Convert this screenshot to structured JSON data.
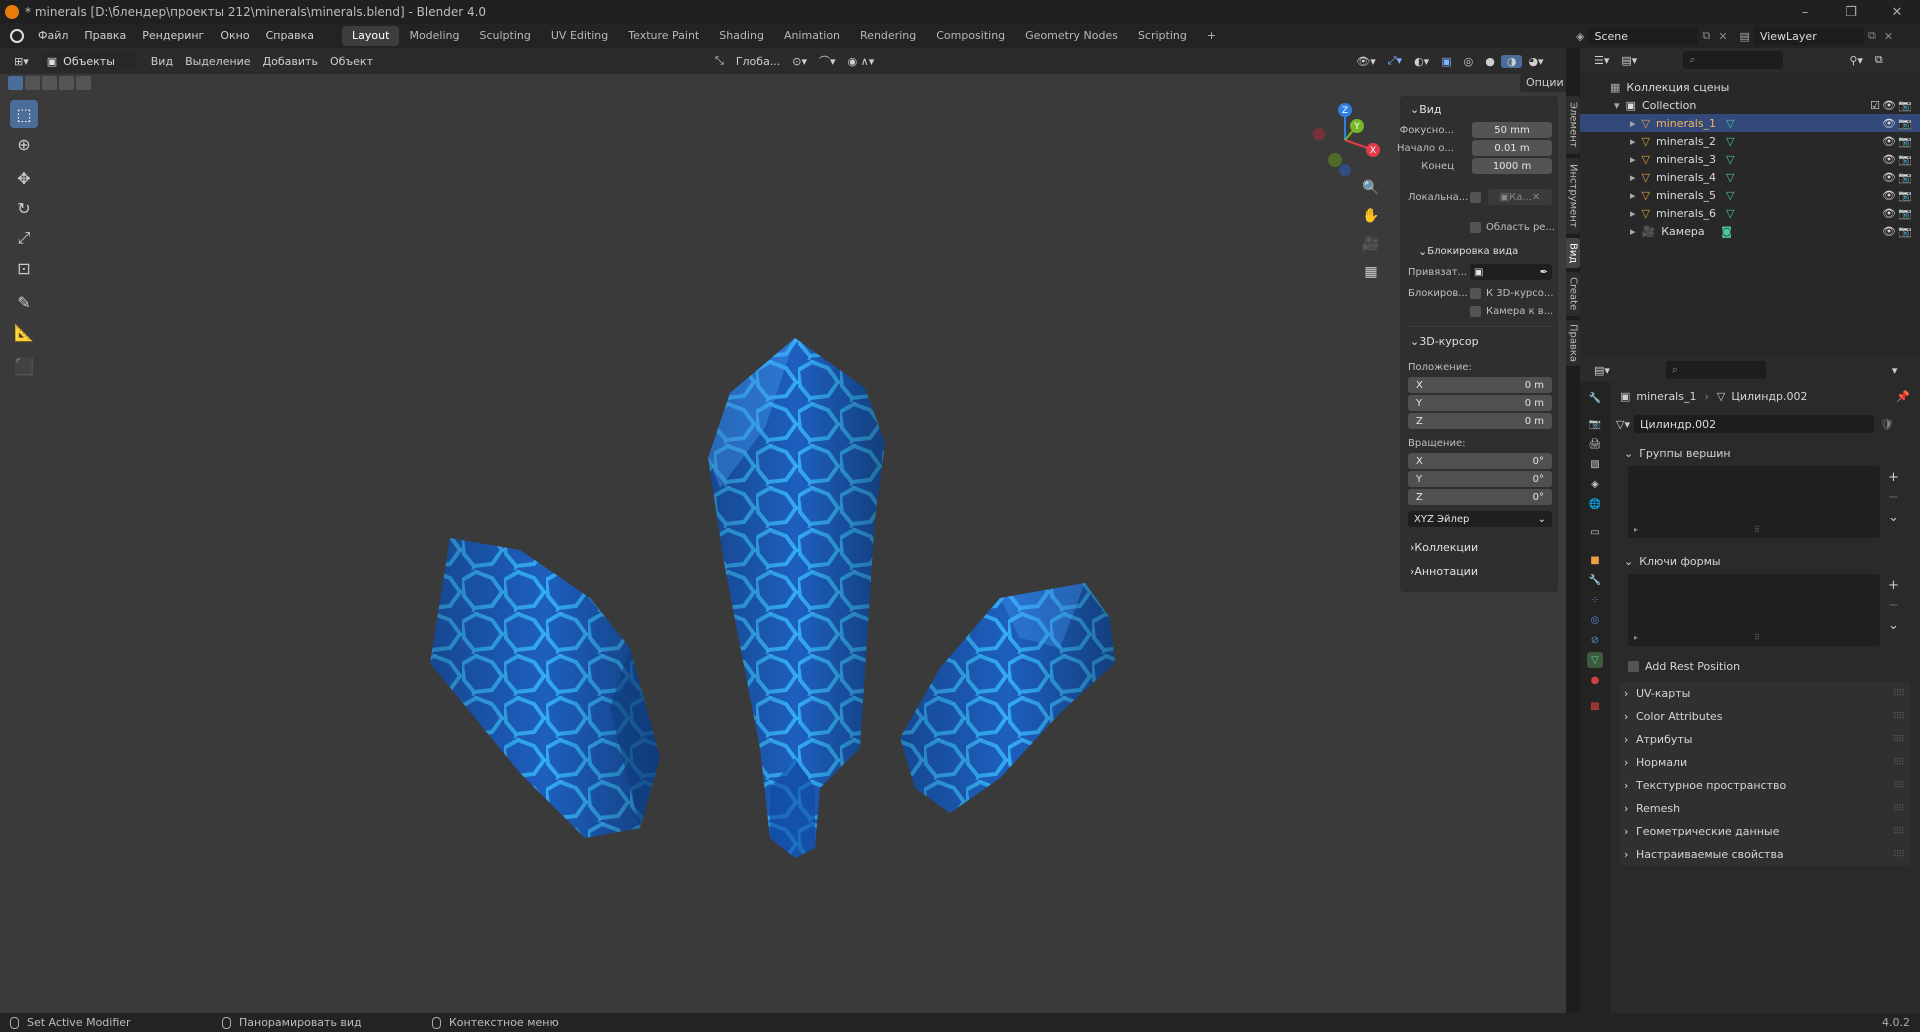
{
  "titlebar": {
    "title": "* minerals [D:\\блендер\\проекты 212\\minerals\\minerals.blend] - Blender 4.0"
  },
  "menus": [
    "Файл",
    "Правка",
    "Рендеринг",
    "Окно",
    "Справка"
  ],
  "workspaces": [
    "Layout",
    "Modeling",
    "Sculpting",
    "UV Editing",
    "Texture Paint",
    "Shading",
    "Animation",
    "Rendering",
    "Compositing",
    "Geometry Nodes",
    "Scripting"
  ],
  "scene": {
    "name": "Scene",
    "view_layer": "ViewLayer"
  },
  "viewport_header": {
    "mode": "Объекты",
    "menus": [
      "Вид",
      "Выделение",
      "Добавить",
      "Объект"
    ],
    "transform_orientation": "Глоба...",
    "options": "Опции"
  },
  "npanel": {
    "view_title": "Вид",
    "focal_label": "Фокусно...",
    "focal_value": "50 mm",
    "clip_start_label": "Начало о...",
    "clip_start_value": "0.01 m",
    "clip_end_label": "Конец",
    "clip_end_value": "1000 m",
    "local_label": "Локальна...",
    "local_value": "Ка...",
    "region_label": "Область ре...",
    "lock_title": "Блокировка вида",
    "lock_to_label": "Привязат...",
    "lock_label": "Блокиров...",
    "lock_cursor": "К 3D-курсо...",
    "lock_camera": "Камера к в...",
    "cursor_title": "3D-курсор",
    "location_label": "Положение:",
    "loc_x_label": "X",
    "loc_x": "0 m",
    "loc_y_label": "Y",
    "loc_y": "0 m",
    "loc_z_label": "Z",
    "loc_z": "0 m",
    "rotation_label": "Вращение:",
    "rot_x_label": "X",
    "rot_x": "0°",
    "rot_y_label": "Y",
    "rot_y": "0°",
    "rot_z_label": "Z",
    "rot_z": "0°",
    "rot_mode": "XYZ Эйлер",
    "collections": "Коллекции",
    "annotations": "Аннотации"
  },
  "side_tabs": [
    "Элемент",
    "Инструмент",
    "Вид",
    "Create",
    "Правка"
  ],
  "outliner": {
    "root": "Коллекция сцены",
    "collection": "Collection",
    "objects": [
      "minerals_1",
      "minerals_2",
      "minerals_3",
      "minerals_4",
      "minerals_5",
      "minerals_6"
    ],
    "camera": "Камера"
  },
  "properties": {
    "object": "minerals_1",
    "mesh": "Цилиндр.002",
    "mesh_field": "Цилиндр.002",
    "vertex_groups": "Группы вершин",
    "shape_keys": "Ключи формы",
    "add_rest_position": "Add Rest Position",
    "panels": [
      "UV-карты",
      "Color Attributes",
      "Атрибуты",
      "Нормали",
      "Текстурное пространство",
      "Remesh",
      "Геометрические данные",
      "Настраиваемые свойства"
    ]
  },
  "statusbar": {
    "left": "Set Active Modifier",
    "middle": "Панорамировать вид",
    "right": "Контекстное меню",
    "version": "4.0.2"
  },
  "colors": {
    "accent": "#4a6d9a",
    "crystal": "#1f6fd1",
    "selected_row": "#33497a"
  }
}
